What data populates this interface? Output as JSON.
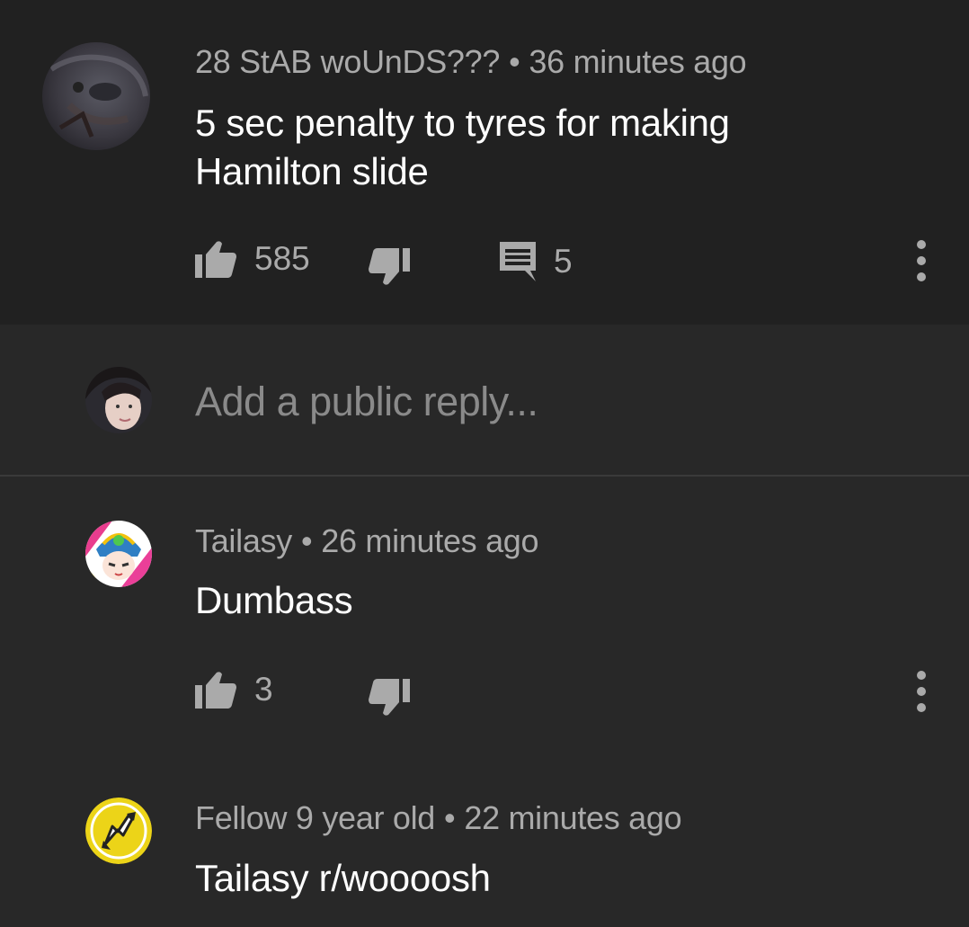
{
  "comment": {
    "author": "28 StAB woUnDS???",
    "separator": "•",
    "time": "36 minutes ago",
    "text_line1": "5 sec penalty to tyres for making",
    "text_line2": "Hamilton slide",
    "likes": "585",
    "replies_count": "5"
  },
  "reply_box": {
    "placeholder": "Add a public reply..."
  },
  "replies": [
    {
      "author": "Tailasy",
      "separator": "•",
      "time": "26 minutes ago",
      "text": "Dumbass",
      "likes": "3"
    },
    {
      "author": "Fellow 9 year old",
      "separator": "•",
      "time": "22 minutes ago",
      "text": "Tailasy r/woooosh"
    }
  ],
  "icons": {
    "like": "thumbs-up-icon",
    "dislike": "thumbs-down-icon",
    "reply": "comment-icon",
    "menu": "more-vertical-icon"
  },
  "colors": {
    "top_background": "#212121",
    "background": "#282828",
    "meta_text": "#aaaaaa",
    "body_text": "#ffffff",
    "icon": "#aaaaaa"
  }
}
